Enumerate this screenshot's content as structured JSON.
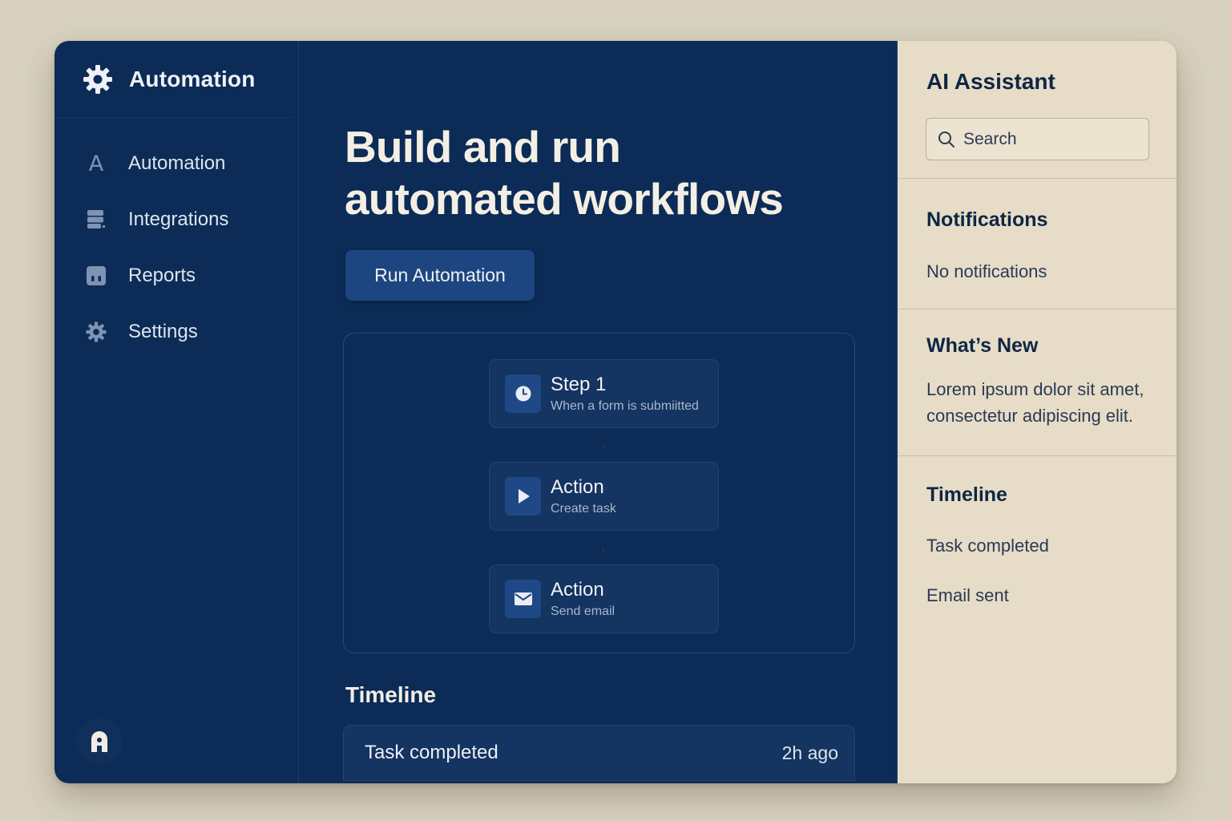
{
  "sidebar": {
    "brand_title": "Automation",
    "items": [
      {
        "label": "Automation",
        "icon": "letter-a-icon",
        "glyph": "A"
      },
      {
        "label": "Integrations",
        "icon": "server-icon"
      },
      {
        "label": "Reports",
        "icon": "reports-icon"
      },
      {
        "label": "Settings",
        "icon": "gear-icon"
      }
    ],
    "avatar_icon": "user-avatar-icon"
  },
  "main": {
    "headline_line1": "Build and run",
    "headline_line2": "automated workflows",
    "run_button": "Run Automation",
    "workflow": [
      {
        "title": "Step 1",
        "subtitle": "When a form is submiitted",
        "icon": "clock-icon"
      },
      {
        "title": "Action",
        "subtitle": "Create task",
        "icon": "play-icon"
      },
      {
        "title": "Action",
        "subtitle": "Send email",
        "icon": "mail-icon"
      }
    ],
    "timeline_title": "Timeline",
    "timeline_rows": [
      {
        "event": "Task completed",
        "time": "2h ago"
      }
    ]
  },
  "panel": {
    "ai_title": "AI Assistant",
    "search_placeholder": "Search",
    "notifications_title": "Notifications",
    "notifications_text": "No notifications",
    "whats_new_title": "What’s New",
    "whats_new_text": "Lorem ipsum dolor sit amet, consectetur adipiscing elit.",
    "timeline_title": "Timeline",
    "timeline_items": [
      "Task completed",
      "Email sent"
    ]
  },
  "colors": {
    "sidebar_bg": "#0c2c57",
    "accent_button": "#1d4680",
    "panel_bg": "#e6dcc7",
    "page_bg": "#d8d1bf"
  }
}
